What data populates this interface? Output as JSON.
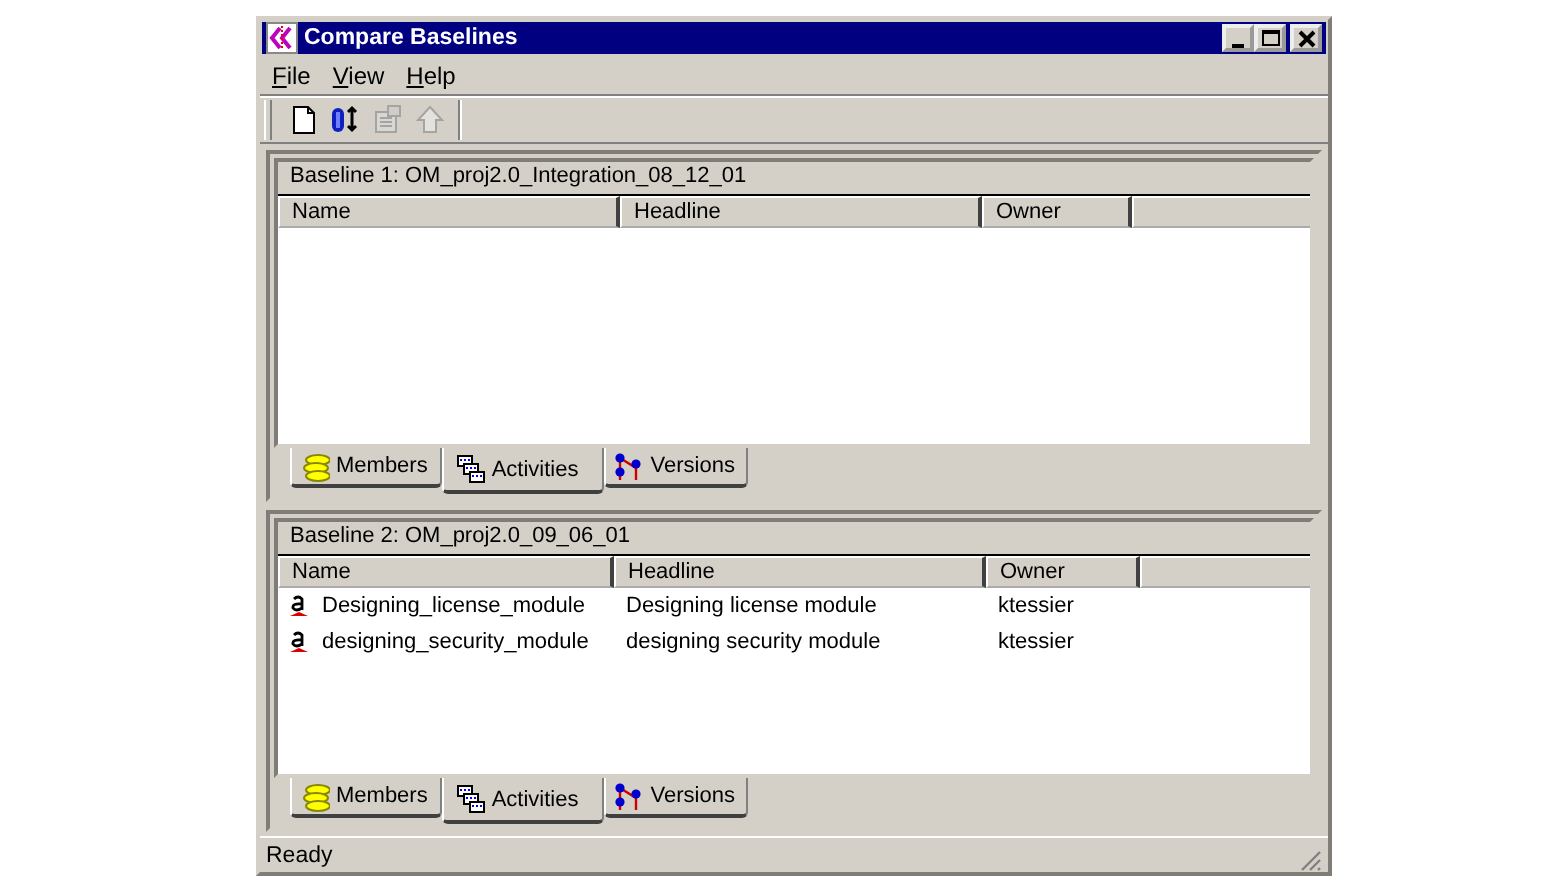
{
  "window": {
    "title": "Compare Baselines"
  },
  "menu": [
    "File",
    "View",
    "Help"
  ],
  "toolbar": [
    {
      "kind": "new",
      "disabled": false
    },
    {
      "kind": "compare",
      "disabled": false
    },
    {
      "kind": "properties",
      "disabled": true
    },
    {
      "kind": "up",
      "disabled": true
    }
  ],
  "panels": [
    {
      "title": "Baseline 1: OM_proj2.0_Integration_08_12_01",
      "columns": [
        "Name",
        "Headline",
        "Owner"
      ],
      "tabs": [
        {
          "label": "Members",
          "kind": "members",
          "selected": false
        },
        {
          "label": "Activities",
          "kind": "activities",
          "selected": true
        },
        {
          "label": "Versions",
          "kind": "versions",
          "selected": false
        }
      ]
    },
    {
      "title": "Baseline 2: OM_proj2.0_09_06_01",
      "columns": [
        "Name",
        "Headline",
        "Owner"
      ],
      "rows": [
        {
          "name": "Designing_license_module",
          "headline": "Designing license module",
          "owner": "ktessier"
        },
        {
          "name": "designing_security_module",
          "headline": "designing security module",
          "owner": "ktessier"
        }
      ],
      "tabs": [
        {
          "label": "Members",
          "kind": "members",
          "selected": false
        },
        {
          "label": "Activities",
          "kind": "activities",
          "selected": true
        },
        {
          "label": "Versions",
          "kind": "versions",
          "selected": false
        }
      ]
    }
  ],
  "status_bar": "Ready"
}
